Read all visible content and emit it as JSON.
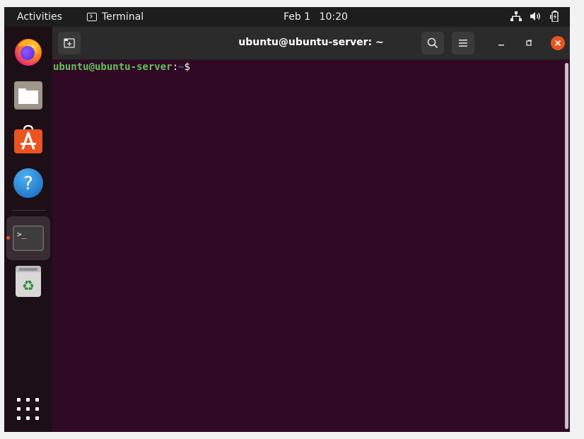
{
  "topbar": {
    "activities": "Activities",
    "app_name": "Terminal",
    "date": "Feb 1",
    "time": "10:20",
    "tray_icons": [
      "network-icon",
      "volume-icon",
      "battery-icon"
    ]
  },
  "dock": {
    "items": [
      {
        "name": "firefox",
        "icon": "firefox-icon"
      },
      {
        "name": "files",
        "icon": "files-icon"
      },
      {
        "name": "ubuntu-software",
        "icon": "software-store-icon"
      },
      {
        "name": "help",
        "icon": "help-icon"
      },
      {
        "name": "terminal",
        "icon": "terminal-icon",
        "running": true
      },
      {
        "name": "trash",
        "icon": "trash-icon"
      }
    ],
    "show_apps_icon": "app-grid-icon"
  },
  "terminal": {
    "title": "ubuntu@ubuntu-server: ~",
    "prompt_user_host": "ubuntu@ubuntu-server",
    "prompt_colon": ":",
    "prompt_path": "~",
    "prompt_symbol": "$",
    "help_glyph": "?",
    "terminal_glyph": ">_"
  },
  "colors": {
    "accent": "#e95420",
    "terminal_bg": "#300a24",
    "prompt_green": "#61c05a",
    "prompt_blue": "#3465a4"
  }
}
